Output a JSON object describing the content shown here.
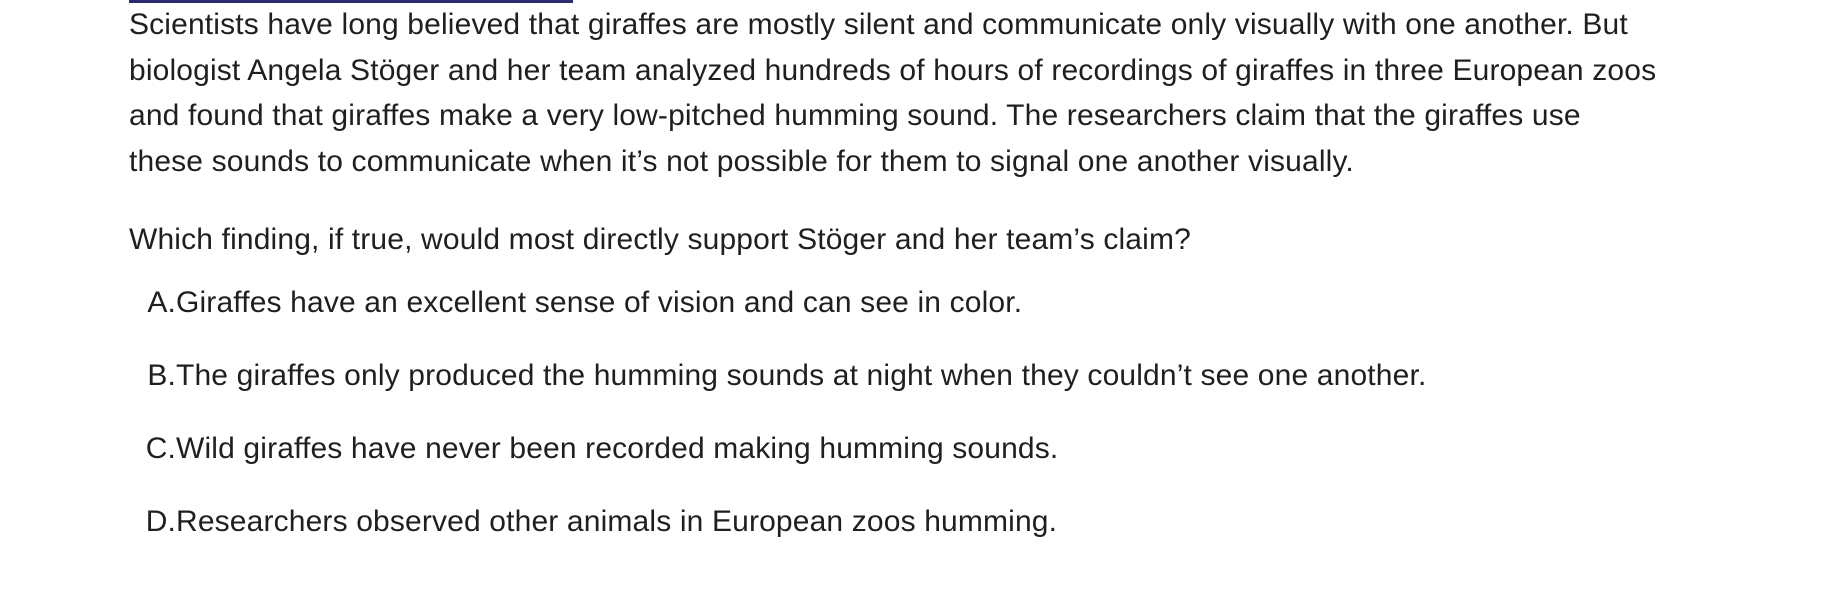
{
  "passage": {
    "lines": [
      "Scientists have long believed that giraffes are mostly silent and communicate only visually with one another. But",
      "biologist Angela Stöger and her team analyzed hundreds of hours of recordings of giraffes in three European zoos",
      "and found that giraffes make a very low-pitched humming sound. The researchers claim that the giraffes use",
      "these sounds to communicate when it’s not possible for them to signal one another visually."
    ]
  },
  "question": {
    "text": "Which finding, if true, would most directly support Stöger and her team’s claim?"
  },
  "choices": [
    {
      "letter": "A.",
      "text": "Giraffes have an excellent sense of vision and can see in color."
    },
    {
      "letter": "B.",
      "text": "The giraffes only produced the humming sounds at night when they couldn’t see one another."
    },
    {
      "letter": "C.",
      "text": "Wild giraffes have never been recorded making humming sounds."
    },
    {
      "letter": "D.",
      "text": "Researchers observed other animals in European zoos humming."
    }
  ],
  "colors": {
    "text": "#1f1f1f",
    "top_rule": "#2b2d6e",
    "background": "#ffffff"
  }
}
